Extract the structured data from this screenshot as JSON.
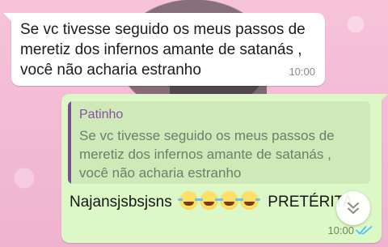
{
  "messages": {
    "incoming": {
      "text": "Se vc tivesse seguido os meus passos de meretiz dos infernos amante de satanás , você não acharia estranho",
      "time": "10:00"
    },
    "outgoing": {
      "quote_author": "Patinho",
      "quote_text": "Se vc tivesse seguido os meus passos de meretiz dos infernos amante de satanás , você não acharia estranho",
      "reply_prefix": "Najansjsbsjsns",
      "reply_emoji": [
        "joy-emoji",
        "joy-emoji",
        "joy-emoji",
        "joy-emoji"
      ],
      "reply_suffix": "PRETÉRITA",
      "time": "10:00",
      "status": "read"
    }
  },
  "controls": {
    "scroll_down_icon": "chevron-double-down-icon"
  },
  "colors": {
    "outgoing_bubble": "#dcf8c6",
    "incoming_bubble": "#ffffff",
    "quote_author": "#8a4fa8",
    "read_ticks": "#4fc3f7",
    "wallpaper": "#f4bcd6"
  }
}
